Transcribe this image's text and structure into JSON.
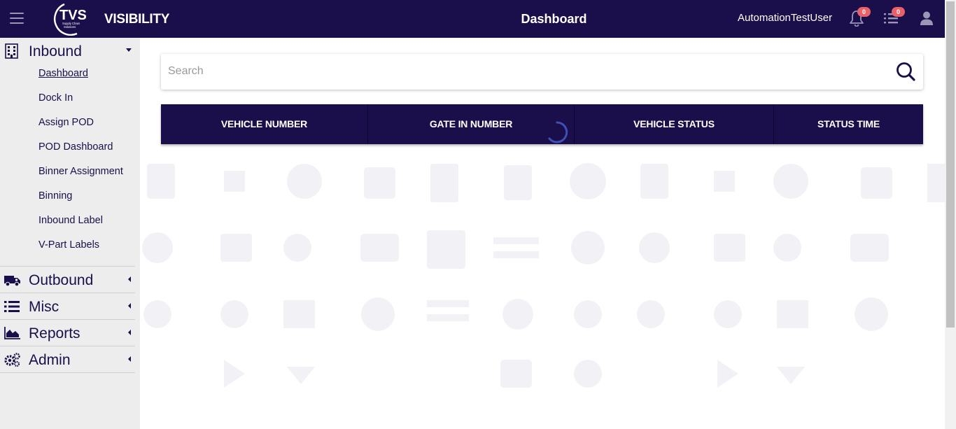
{
  "header": {
    "logo_text": "TVS",
    "logo_subtext": "Supply Chain Solutions",
    "brand": "VISIBILITY",
    "title": "Dashboard",
    "username": "AutomationTestUser",
    "notifications_count": "0",
    "tasks_count": "0",
    "icons": [
      "menu-icon",
      "bell-icon",
      "list-icon",
      "user-icon"
    ]
  },
  "sidebar": {
    "inbound": {
      "label": "Inbound",
      "icon": "building-icon",
      "items": [
        "Dashboard",
        "Dock In",
        "Assign POD",
        "POD Dashboard",
        "Binner Assignment",
        "Binning",
        "Inbound Label",
        "V-Part Labels"
      ]
    },
    "outbound": {
      "label": "Outbound",
      "icon": "truck-icon"
    },
    "misc": {
      "label": "Misc",
      "icon": "list-icon"
    },
    "reports": {
      "label": "Reports",
      "icon": "area-chart-icon"
    },
    "admin": {
      "label": "Admin",
      "icon": "cogs-icon"
    }
  },
  "search": {
    "placeholder": "Search",
    "value": ""
  },
  "table": {
    "columns": [
      "VEHICLE NUMBER",
      "GATE IN NUMBER",
      "VEHICLE STATUS",
      "STATUS TIME"
    ],
    "rows": []
  },
  "colors": {
    "primary": "#1b0f4b",
    "sidebar_bg": "#ededed",
    "badge": "#e8606a",
    "spinner": "#3f51b5"
  }
}
